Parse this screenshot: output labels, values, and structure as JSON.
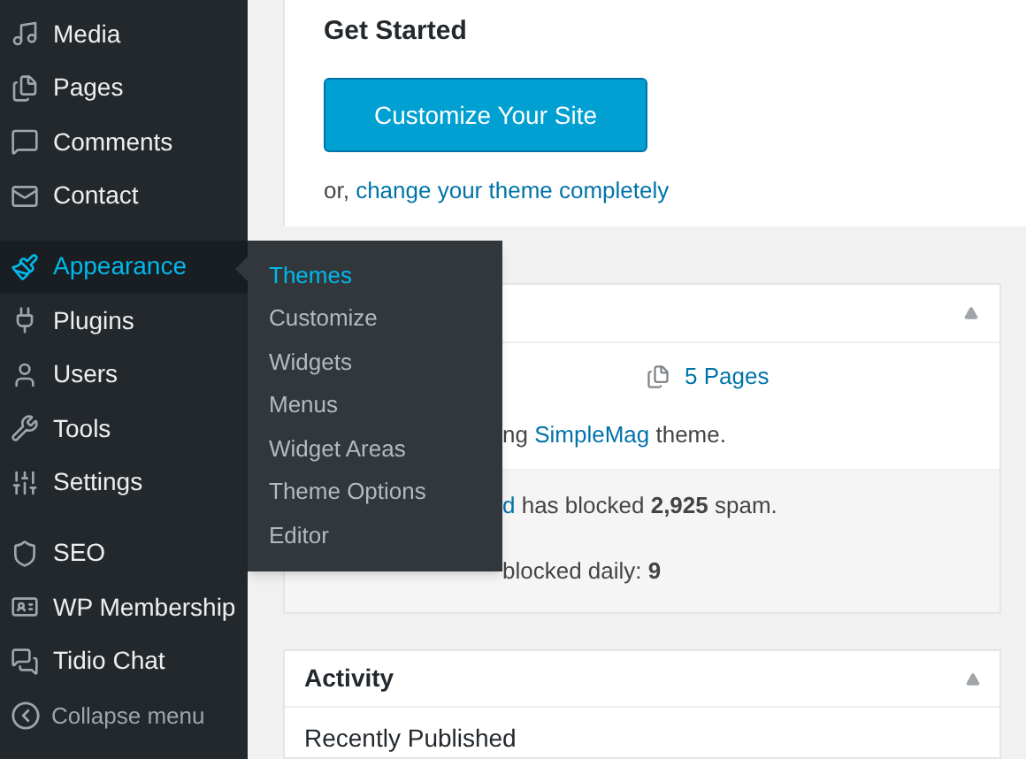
{
  "sidebar": {
    "groups": [
      {
        "items": [
          {
            "label": "Media",
            "selected": false
          },
          {
            "label": "Pages",
            "selected": false
          },
          {
            "label": "Comments",
            "selected": false
          },
          {
            "label": "Contact",
            "selected": false
          }
        ]
      },
      {
        "items": [
          {
            "label": "Appearance",
            "selected": true
          },
          {
            "label": "Plugins",
            "selected": false
          },
          {
            "label": "Users",
            "selected": false
          },
          {
            "label": "Tools",
            "selected": false
          },
          {
            "label": "Settings",
            "selected": false
          }
        ]
      },
      {
        "items": [
          {
            "label": "SEO",
            "selected": false
          },
          {
            "label": "WP Membership",
            "selected": false
          },
          {
            "label": "Tidio Chat",
            "selected": false
          }
        ]
      }
    ],
    "collapse": "Collapse menu"
  },
  "flyout": {
    "items": [
      {
        "label": "Themes",
        "selected": true
      },
      {
        "label": "Customize",
        "selected": false
      },
      {
        "label": "Widgets",
        "selected": false
      },
      {
        "label": "Menus",
        "selected": false
      },
      {
        "label": "Widget Areas",
        "selected": false
      },
      {
        "label": "Theme Options",
        "selected": false
      },
      {
        "label": "Editor",
        "selected": false
      }
    ]
  },
  "welcome": {
    "title": "Get Started",
    "button": "Customize Your Site",
    "or_text": "or, ",
    "link": "change your theme completely"
  },
  "glance": {
    "pages": "5 Pages",
    "theme_prefix": "ng ",
    "theme_link": "SimpleMag",
    "theme_suffix": " theme.",
    "spam_link": "d",
    "spam_text": " has blocked **2,925** spam.",
    "daily_text": "blocked daily: **9**"
  },
  "activity": {
    "title": "Activity",
    "section": "Recently Published"
  }
}
